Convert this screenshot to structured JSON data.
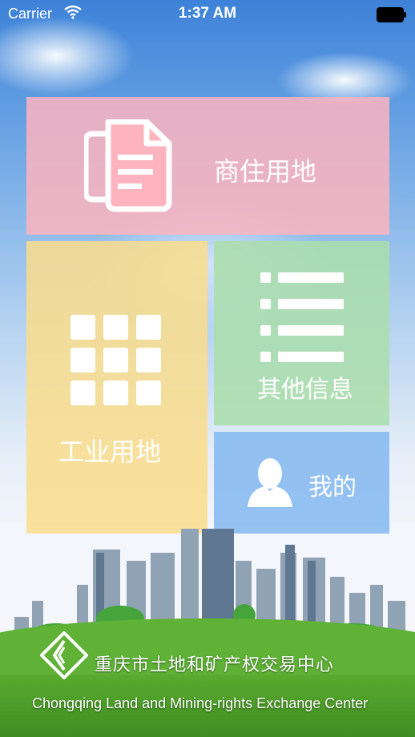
{
  "status_bar": {
    "carrier": "Carrier",
    "time": "1:37 AM"
  },
  "tiles": [
    {
      "id": "commercial-residential-land",
      "label": "商住用地",
      "icon": "document-icon",
      "color": "#fdb4be"
    },
    {
      "id": "industrial-land",
      "label": "工业用地",
      "icon": "grid-icon",
      "color": "#fadd8c"
    },
    {
      "id": "other-info",
      "label": "其他信息",
      "icon": "list-icon",
      "color": "#aadeaa"
    },
    {
      "id": "my-profile",
      "label": "我的",
      "icon": "user-icon",
      "color": "#82b9f0"
    }
  ],
  "footer": {
    "title_cn": "重庆市土地和矿产权交易中心",
    "title_en": "Chongqing Land and Mining-rights Exchange Center"
  }
}
